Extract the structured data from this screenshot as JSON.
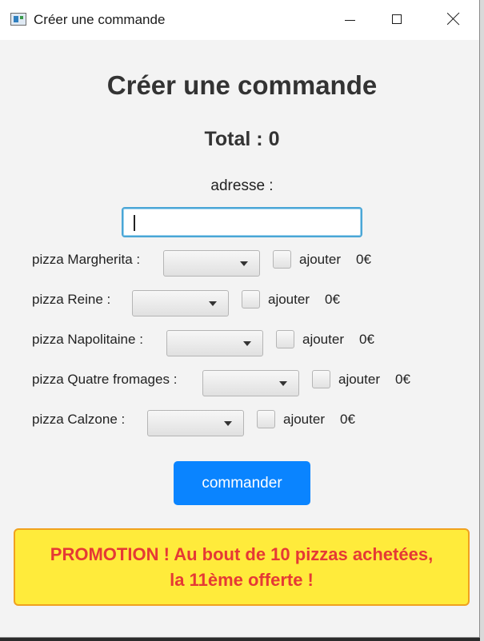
{
  "window": {
    "title": "Créer une commande"
  },
  "page": {
    "heading": "Créer une commande",
    "total": "Total : 0",
    "address_label": "adresse :",
    "address_value": ""
  },
  "pizzas": [
    {
      "label": "pizza Margherita :",
      "add_label": "ajouter",
      "price": "0€",
      "checked": false
    },
    {
      "label": "pizza Reine :",
      "add_label": "ajouter",
      "price": "0€",
      "checked": false
    },
    {
      "label": "pizza Napolitaine :",
      "add_label": "ajouter",
      "price": "0€",
      "checked": false
    },
    {
      "label": "pizza Quatre fromages :",
      "add_label": "ajouter",
      "price": "0€",
      "checked": false
    },
    {
      "label": "pizza Calzone :",
      "add_label": "ajouter",
      "price": "0€",
      "checked": false
    }
  ],
  "actions": {
    "order_label": "commander"
  },
  "promo": {
    "line1": "PROMOTION ! Au bout de 10 pizzas achetées,",
    "line2": "la 11ème offerte !"
  },
  "colors": {
    "accent": "#0a84ff",
    "promo_bg": "#ffeb3b",
    "promo_text": "#e53935",
    "promo_border": "#f0a11f"
  },
  "icons": [
    "app-icon",
    "minimize-icon",
    "maximize-icon",
    "close-icon",
    "chevron-down-icon"
  ]
}
